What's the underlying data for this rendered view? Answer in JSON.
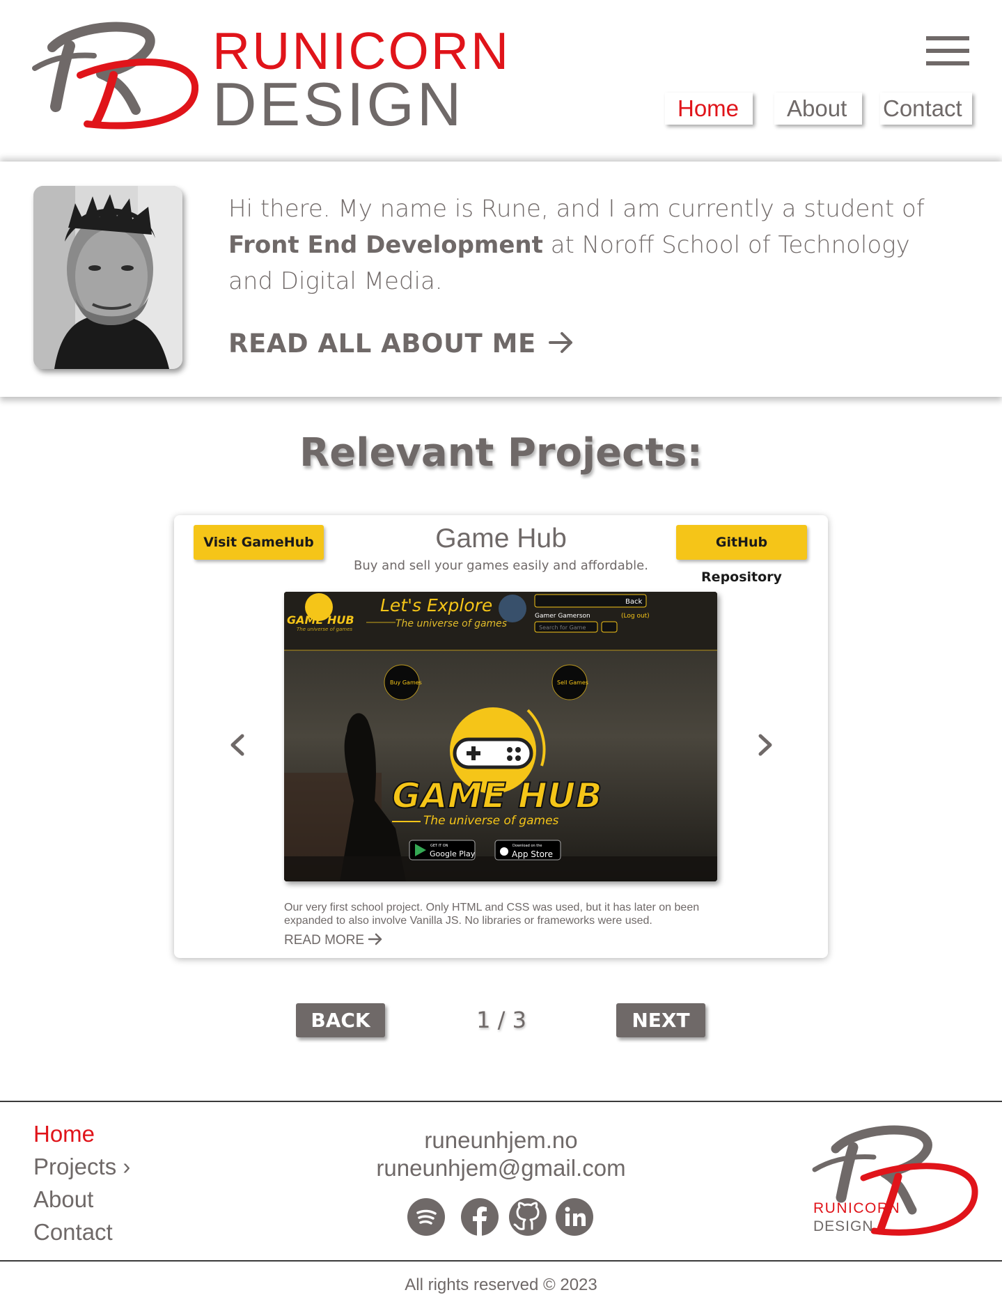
{
  "header": {
    "brand_line1": "RUNICORN",
    "brand_line2": "DESIGN",
    "logo_icon": "rd-monogram-logo",
    "menu_icon": "hamburger-menu-icon",
    "nav": [
      {
        "label": "Home",
        "active": true
      },
      {
        "label": "About",
        "active": false
      },
      {
        "label": "Contact",
        "active": false
      }
    ]
  },
  "intro": {
    "text_before": "Hi there. My name is Rune, and I am currently a student of ",
    "text_bold": "Front End Development",
    "text_after": " at Noroff School of Technology and Digital Media.",
    "about_link": "READ ALL ABOUT ME"
  },
  "projects": {
    "heading": "Relevant Projects:",
    "card": {
      "visit_button": "Visit GameHub",
      "repo_button": "GitHub Repository",
      "title": "Game Hub",
      "subtitle": "Buy and sell your games easily and affordable.",
      "description": "Our very first school project. Only HTML and CSS was used, but it has later on been expanded to also involve Vanilla JS. No libraries or frameworks were used.",
      "read_more": "READ MORE",
      "screenshot": {
        "logo_small": "GAME HUB",
        "logo_small_tag": "The universe of games",
        "headline": "Let's Explore",
        "tagline": "The universe of games",
        "user_name": "Gamer Gamerson",
        "logout": "(Log out)",
        "search_placeholder": "Search for Game",
        "back_label": "Back",
        "buy_label": "Buy Games",
        "sell_label": "Sell Games",
        "big_logo": "GAME HUB",
        "big_tagline": "The universe of games",
        "google_small": "GET IT ON",
        "google_big": "Google Play",
        "apple_small": "Download on the",
        "apple_big": "App Store"
      }
    },
    "pager": {
      "back": "BACK",
      "count": "1 / 3",
      "next": "NEXT"
    }
  },
  "footer": {
    "nav": [
      {
        "label": "Home",
        "active": true
      },
      {
        "label": "Projects ›",
        "active": false
      },
      {
        "label": "About",
        "active": false
      },
      {
        "label": "Contact",
        "active": false
      }
    ],
    "website": "runeunhjem.no",
    "email": "runeunhjem@gmail.com",
    "socials": [
      "spotify-icon",
      "facebook-icon",
      "github-icon",
      "linkedin-icon"
    ],
    "brand_line1": "RUNICORN",
    "brand_line2": "DESIGN",
    "copyright": "All rights reserved © 2023"
  },
  "colors": {
    "accent": "#e0141a",
    "text": "#6f6968",
    "button_yellow": "#f5c518"
  }
}
